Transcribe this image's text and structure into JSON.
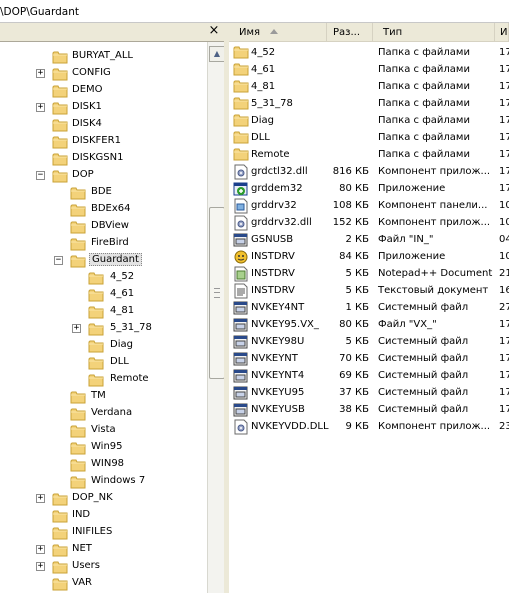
{
  "address_path": "\\DOP\\Guardant",
  "tree_pane": {
    "close_glyph": "×"
  },
  "tree": [
    {
      "label": "BURYAT_ALL",
      "expander": "",
      "level": 2,
      "selected": false
    },
    {
      "label": "CONFIG",
      "expander": "+",
      "level": 2,
      "selected": false
    },
    {
      "label": "DEMO",
      "expander": "",
      "level": 2,
      "selected": false
    },
    {
      "label": "DISK1",
      "expander": "+",
      "level": 2,
      "selected": false
    },
    {
      "label": "DISK4",
      "expander": "",
      "level": 2,
      "selected": false
    },
    {
      "label": "DISKFER1",
      "expander": "",
      "level": 2,
      "selected": false
    },
    {
      "label": "DISKGSN1",
      "expander": "",
      "level": 2,
      "selected": false
    },
    {
      "label": "DOP",
      "expander": "−",
      "level": 2,
      "selected": false
    },
    {
      "label": "BDE",
      "expander": "",
      "level": 3,
      "selected": false
    },
    {
      "label": "BDEx64",
      "expander": "",
      "level": 3,
      "selected": false
    },
    {
      "label": "DBView",
      "expander": "",
      "level": 3,
      "selected": false
    },
    {
      "label": "FireBird",
      "expander": "",
      "level": 3,
      "selected": false
    },
    {
      "label": "Guardant",
      "expander": "−",
      "level": 3,
      "selected": true
    },
    {
      "label": "4_52",
      "expander": "",
      "level": 4,
      "selected": false
    },
    {
      "label": "4_61",
      "expander": "",
      "level": 4,
      "selected": false
    },
    {
      "label": "4_81",
      "expander": "",
      "level": 4,
      "selected": false
    },
    {
      "label": "5_31_78",
      "expander": "+",
      "level": 4,
      "selected": false
    },
    {
      "label": "Diag",
      "expander": "",
      "level": 4,
      "selected": false
    },
    {
      "label": "DLL",
      "expander": "",
      "level": 4,
      "selected": false
    },
    {
      "label": "Remote",
      "expander": "",
      "level": 4,
      "selected": false
    },
    {
      "label": "TM",
      "expander": "",
      "level": 3,
      "selected": false
    },
    {
      "label": "Verdana",
      "expander": "",
      "level": 3,
      "selected": false
    },
    {
      "label": "Vista",
      "expander": "",
      "level": 3,
      "selected": false
    },
    {
      "label": "Win95",
      "expander": "",
      "level": 3,
      "selected": false
    },
    {
      "label": "WIN98",
      "expander": "",
      "level": 3,
      "selected": false
    },
    {
      "label": "Windows 7",
      "expander": "",
      "level": 3,
      "selected": false
    },
    {
      "label": "DOP_NK",
      "expander": "+",
      "level": 2,
      "selected": false
    },
    {
      "label": "IND",
      "expander": "",
      "level": 2,
      "selected": false
    },
    {
      "label": "INIFILES",
      "expander": "",
      "level": 2,
      "selected": false
    },
    {
      "label": "NET",
      "expander": "+",
      "level": 2,
      "selected": false
    },
    {
      "label": "Users",
      "expander": "+",
      "level": 2,
      "selected": false
    },
    {
      "label": "VAR",
      "expander": "",
      "level": 2,
      "selected": false
    }
  ],
  "columns": {
    "name": "Имя",
    "size": "Раз...",
    "type": "Тип",
    "modified": "И"
  },
  "files": [
    {
      "name": "4_52",
      "size": "",
      "type": "Папка с файлами",
      "modified": "17",
      "icon": "folder-icon"
    },
    {
      "name": "4_61",
      "size": "",
      "type": "Папка с файлами",
      "modified": "17",
      "icon": "folder-icon"
    },
    {
      "name": "4_81",
      "size": "",
      "type": "Папка с файлами",
      "modified": "17",
      "icon": "folder-icon"
    },
    {
      "name": "5_31_78",
      "size": "",
      "type": "Папка с файлами",
      "modified": "17",
      "icon": "folder-icon"
    },
    {
      "name": "Diag",
      "size": "",
      "type": "Папка с файлами",
      "modified": "17",
      "icon": "folder-icon"
    },
    {
      "name": "DLL",
      "size": "",
      "type": "Папка с файлами",
      "modified": "17",
      "icon": "folder-icon"
    },
    {
      "name": "Remote",
      "size": "",
      "type": "Папка с файлами",
      "modified": "17",
      "icon": "folder-icon"
    },
    {
      "name": "grdctl32.dll",
      "size": "816 КБ",
      "type": "Компонент прилож...",
      "modified": "17",
      "icon": "dll-icon"
    },
    {
      "name": "grddem32",
      "size": "80 КБ",
      "type": "Приложение",
      "modified": "17",
      "icon": "app-icon"
    },
    {
      "name": "grddrv32",
      "size": "108 КБ",
      "type": "Компонент панели...",
      "modified": "10",
      "icon": "control-panel-icon"
    },
    {
      "name": "grddrv32.dll",
      "size": "152 КБ",
      "type": "Компонент прилож...",
      "modified": "10",
      "icon": "dll-icon"
    },
    {
      "name": "GSNUSB",
      "size": "2 КБ",
      "type": "Файл \"IN_\"",
      "modified": "04",
      "icon": "system-file-icon"
    },
    {
      "name": "INSTDRV",
      "size": "84 КБ",
      "type": "Приложение",
      "modified": "10",
      "icon": "installer-icon"
    },
    {
      "name": "INSTDRV",
      "size": "5 КБ",
      "type": "Notepad++ Document",
      "modified": "21",
      "icon": "notepad-icon"
    },
    {
      "name": "INSTDRV",
      "size": "5 КБ",
      "type": "Текстовый документ",
      "modified": "16",
      "icon": "text-file-icon"
    },
    {
      "name": "NVKEY4NT",
      "size": "1 КБ",
      "type": "Системный файл",
      "modified": "27",
      "icon": "system-file-icon"
    },
    {
      "name": "NVKEY95.VX_",
      "size": "80 КБ",
      "type": "Файл \"VX_\"",
      "modified": "17",
      "icon": "system-file-icon"
    },
    {
      "name": "NVKEY98U",
      "size": "5 КБ",
      "type": "Системный файл",
      "modified": "17",
      "icon": "system-file-icon"
    },
    {
      "name": "NVKEYNT",
      "size": "70 КБ",
      "type": "Системный файл",
      "modified": "17",
      "icon": "system-file-icon"
    },
    {
      "name": "NVKEYNT4",
      "size": "69 КБ",
      "type": "Системный файл",
      "modified": "17",
      "icon": "system-file-icon"
    },
    {
      "name": "NVKEYU95",
      "size": "37 КБ",
      "type": "Системный файл",
      "modified": "17",
      "icon": "system-file-icon"
    },
    {
      "name": "NVKEYUSB",
      "size": "38 КБ",
      "type": "Системный файл",
      "modified": "17",
      "icon": "system-file-icon"
    },
    {
      "name": "NVKEYVDD.DLL",
      "size": "9 КБ",
      "type": "Компонент прилож...",
      "modified": "23",
      "icon": "dll-icon"
    }
  ]
}
